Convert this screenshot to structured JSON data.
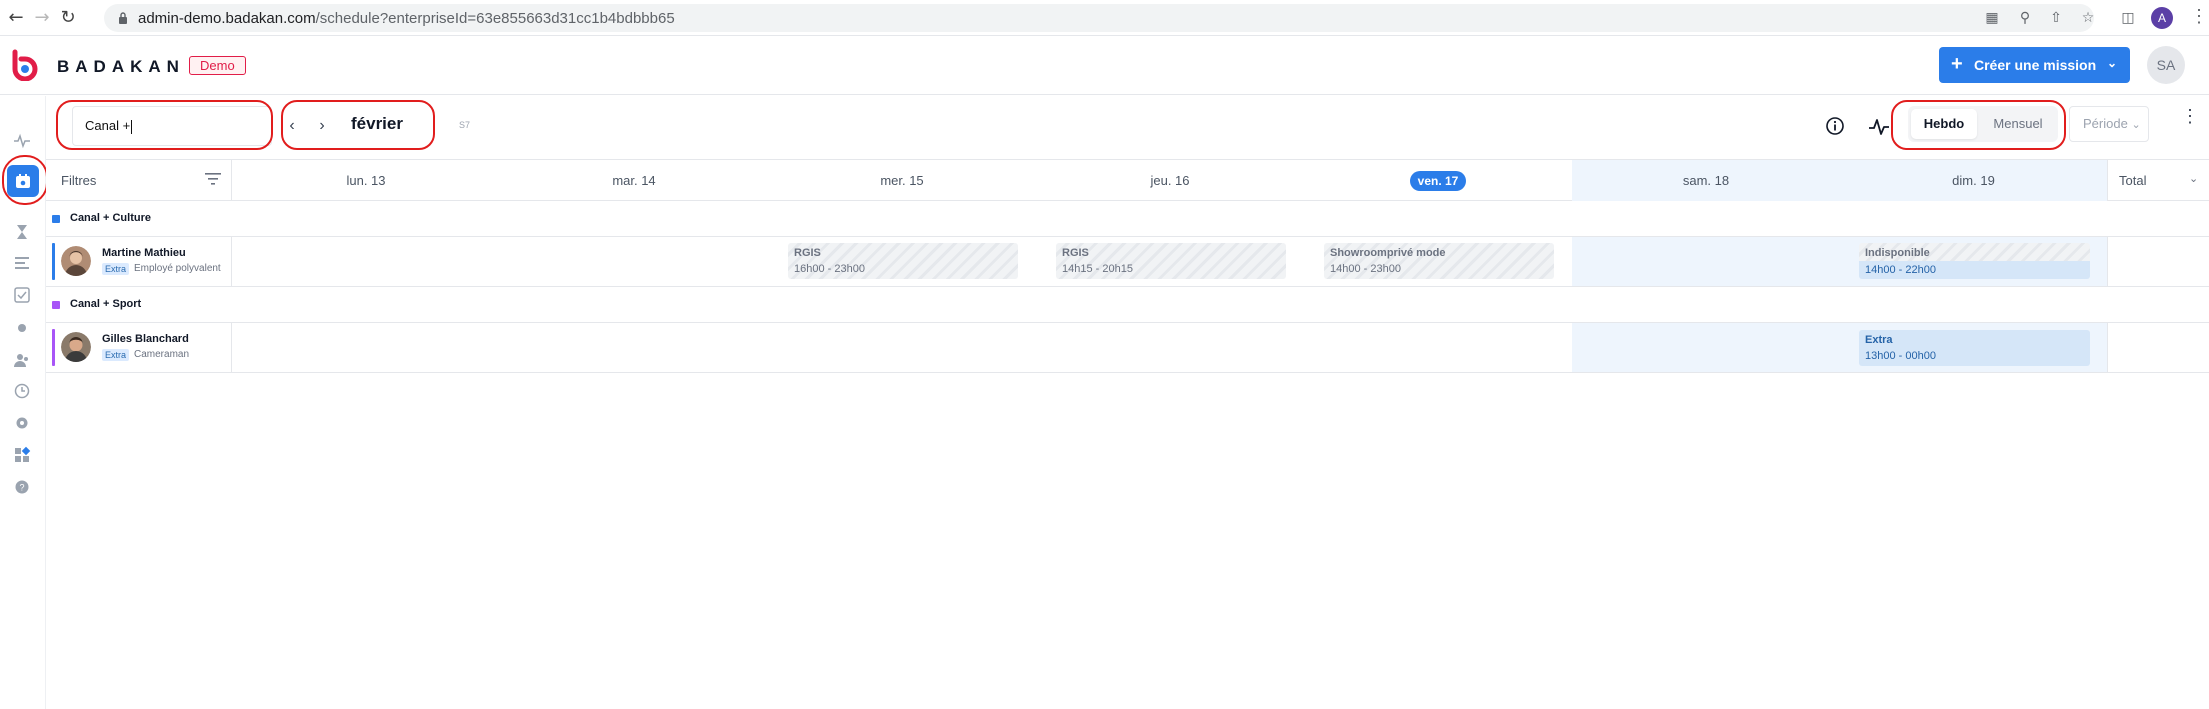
{
  "browser": {
    "url_host": "admin-demo.badakan.com",
    "url_path": "/schedule?enterpriseId=63e855663d31cc1b4bdbbb65",
    "profile_initial": "A"
  },
  "header": {
    "brand": "BADAKAN",
    "badge": "Demo",
    "create_button": "Créer une mission",
    "user_initials": "SA"
  },
  "toolbar": {
    "search_value": "Canal +",
    "month": "février",
    "week_number": "S7",
    "view_hebdo": "Hebdo",
    "view_mensuel": "Mensuel",
    "period": "Période"
  },
  "grid": {
    "filters_label": "Filtres",
    "total_label": "Total",
    "days": [
      {
        "label": "lun. 13",
        "today": false,
        "weekend": false
      },
      {
        "label": "mar. 14",
        "today": false,
        "weekend": false
      },
      {
        "label": "mer. 15",
        "today": false,
        "weekend": false
      },
      {
        "label": "jeu. 16",
        "today": false,
        "weekend": false
      },
      {
        "label": "ven. 17",
        "today": true,
        "weekend": false
      },
      {
        "label": "sam. 18",
        "today": false,
        "weekend": true
      },
      {
        "label": "dim. 19",
        "today": false,
        "weekend": true
      }
    ],
    "groups": [
      {
        "name": "Canal + Culture",
        "color": "#2b7de9",
        "employees": [
          {
            "name": "Martine Mathieu",
            "tag": "Extra",
            "role": "Employé polyvalent",
            "shifts": [
              {
                "title": "RGIS",
                "time": "16h00 - 23h00"
              },
              {
                "title": "RGIS",
                "time": "14h15 - 20h15"
              },
              {
                "title": "Showroomprivé mode",
                "time": "14h00 - 23h00"
              },
              {
                "title": "Indisponible",
                "time": "14h00 - 22h00"
              }
            ]
          }
        ]
      },
      {
        "name": "Canal + Sport",
        "color": "#a855f7",
        "employees": [
          {
            "name": "Gilles Blanchard",
            "tag": "Extra",
            "role": "Cameraman",
            "shifts": [
              {
                "title": "Extra",
                "time": "13h00 - 00h00"
              }
            ]
          }
        ]
      }
    ]
  },
  "colors": {
    "accent": "#2b7de9",
    "brand_red": "#e11d48",
    "annotation_red": "#e11d1d",
    "weekend_bg": "#eef5fd"
  },
  "icons": {
    "rail": [
      "activity-icon",
      "calendar-icon",
      "hourglass-icon",
      "list-icon",
      "checklist-icon",
      "dot-icon",
      "users-icon",
      "clock-icon",
      "settings-icon",
      "apps-icon",
      "help-icon"
    ]
  }
}
